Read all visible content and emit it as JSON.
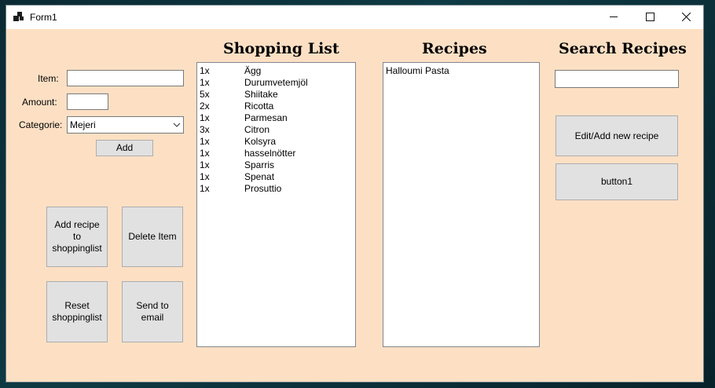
{
  "window": {
    "title": "Form1"
  },
  "form": {
    "item_label": "Item:",
    "item_value": "",
    "amount_label": "Amount:",
    "amount_value": "",
    "category_label": "Categorie:",
    "category_value": "Mejeri",
    "add_label": "Add"
  },
  "actions": {
    "add_recipe_label": "Add recipe\nto\nshoppinglist",
    "delete_item_label": "Delete Item",
    "reset_label": "Reset\nshoppinglist",
    "send_email_label": "Send to\nemail"
  },
  "shopping": {
    "heading": "Shopping List",
    "items": [
      {
        "qty": "1x",
        "name": "Ägg"
      },
      {
        "qty": "1x",
        "name": "Durumvetemjöl"
      },
      {
        "qty": "5x",
        "name": "Shiitake"
      },
      {
        "qty": "2x",
        "name": "Ricotta"
      },
      {
        "qty": "1x",
        "name": "Parmesan"
      },
      {
        "qty": "3x",
        "name": "Citron"
      },
      {
        "qty": "1x",
        "name": "Kolsyra"
      },
      {
        "qty": "1x",
        "name": "hasselnötter"
      },
      {
        "qty": "1x",
        "name": "Sparris"
      },
      {
        "qty": "1x",
        "name": "Spenat"
      },
      {
        "qty": "1x",
        "name": "Prosuttio"
      }
    ]
  },
  "recipes": {
    "heading": "Recipes",
    "items": [
      "Halloumi Pasta"
    ]
  },
  "search": {
    "heading": "Search Recipes",
    "value": "",
    "edit_label": "Edit/Add new recipe",
    "button1_label": "button1"
  },
  "colors": {
    "form_background": "#fde0c4",
    "button_face": "#e1e1e1"
  }
}
